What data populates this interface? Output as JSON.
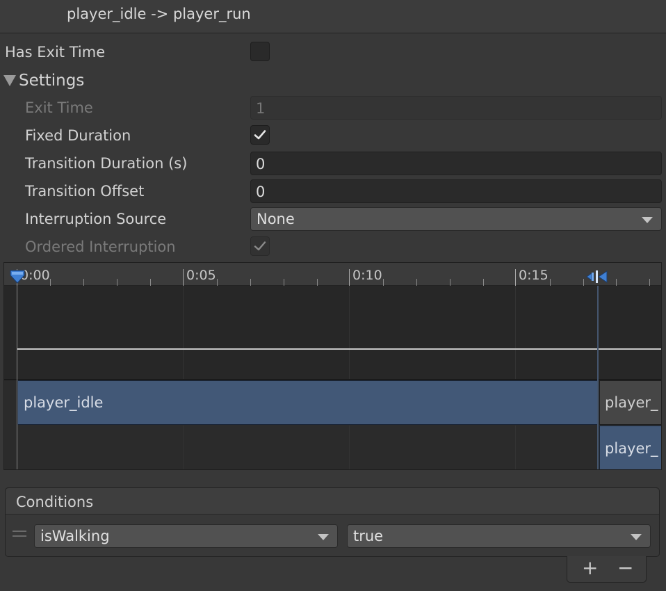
{
  "header": {
    "title": "player_idle -> player_run"
  },
  "settings": {
    "has_exit_time_label": "Has Exit Time",
    "has_exit_time_checked": false,
    "foldout_label": "Settings",
    "exit_time_label": "Exit Time",
    "exit_time_value": "1",
    "fixed_duration_label": "Fixed Duration",
    "fixed_duration_checked": true,
    "transition_duration_label": "Transition Duration (s)",
    "transition_duration_value": "0",
    "transition_offset_label": "Transition Offset",
    "transition_offset_value": "0",
    "interruption_source_label": "Interruption Source",
    "interruption_source_value": "None",
    "ordered_interruption_label": "Ordered Interruption",
    "ordered_interruption_checked": true
  },
  "timeline": {
    "ticks": [
      "0:00",
      "0:05",
      "0:10",
      "0:15"
    ],
    "source_clip": "player_idle",
    "dest_clip_top": "player_",
    "dest_clip_bottom": "player_"
  },
  "conditions": {
    "title": "Conditions",
    "items": [
      {
        "parameter": "isWalking",
        "value": "true"
      }
    ],
    "add_label": "+",
    "remove_label": "−"
  },
  "colors": {
    "background": "#383838",
    "clip_blue": "#425877",
    "marker_blue": "#3f7fd3"
  }
}
